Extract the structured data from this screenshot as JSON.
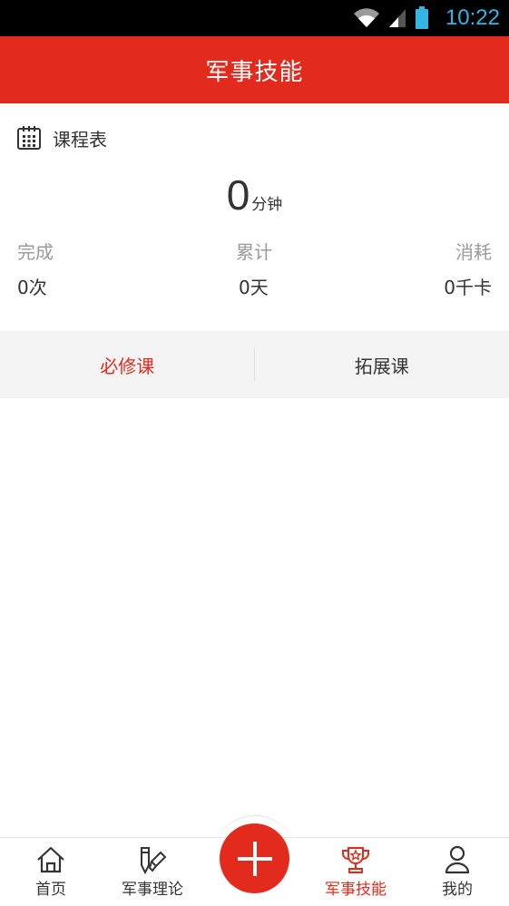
{
  "status_bar": {
    "time": "10:22"
  },
  "header": {
    "title": "军事技能"
  },
  "schedule": {
    "label": "课程表"
  },
  "summary": {
    "total_minutes": "0",
    "total_unit": "分钟",
    "stats": [
      {
        "label": "完成",
        "value": "0次"
      },
      {
        "label": "累计",
        "value": "0天"
      },
      {
        "label": "消耗",
        "value": "0千卡"
      }
    ]
  },
  "tabs": [
    {
      "label": "必修课",
      "active": true
    },
    {
      "label": "拓展课",
      "active": false
    }
  ],
  "bottom_nav": {
    "items": [
      {
        "label": "首页",
        "icon": "home-icon",
        "active": false
      },
      {
        "label": "军事理论",
        "icon": "military-theory-icon",
        "active": false
      },
      {
        "label": "军事技能",
        "icon": "trophy-icon",
        "active": true
      },
      {
        "label": "我的",
        "icon": "person-icon",
        "active": false
      }
    ],
    "center_action": {
      "icon": "plus-icon"
    }
  },
  "colors": {
    "accent": "#e32b1d",
    "statusbar": "#000000",
    "time": "#33b5e5"
  }
}
